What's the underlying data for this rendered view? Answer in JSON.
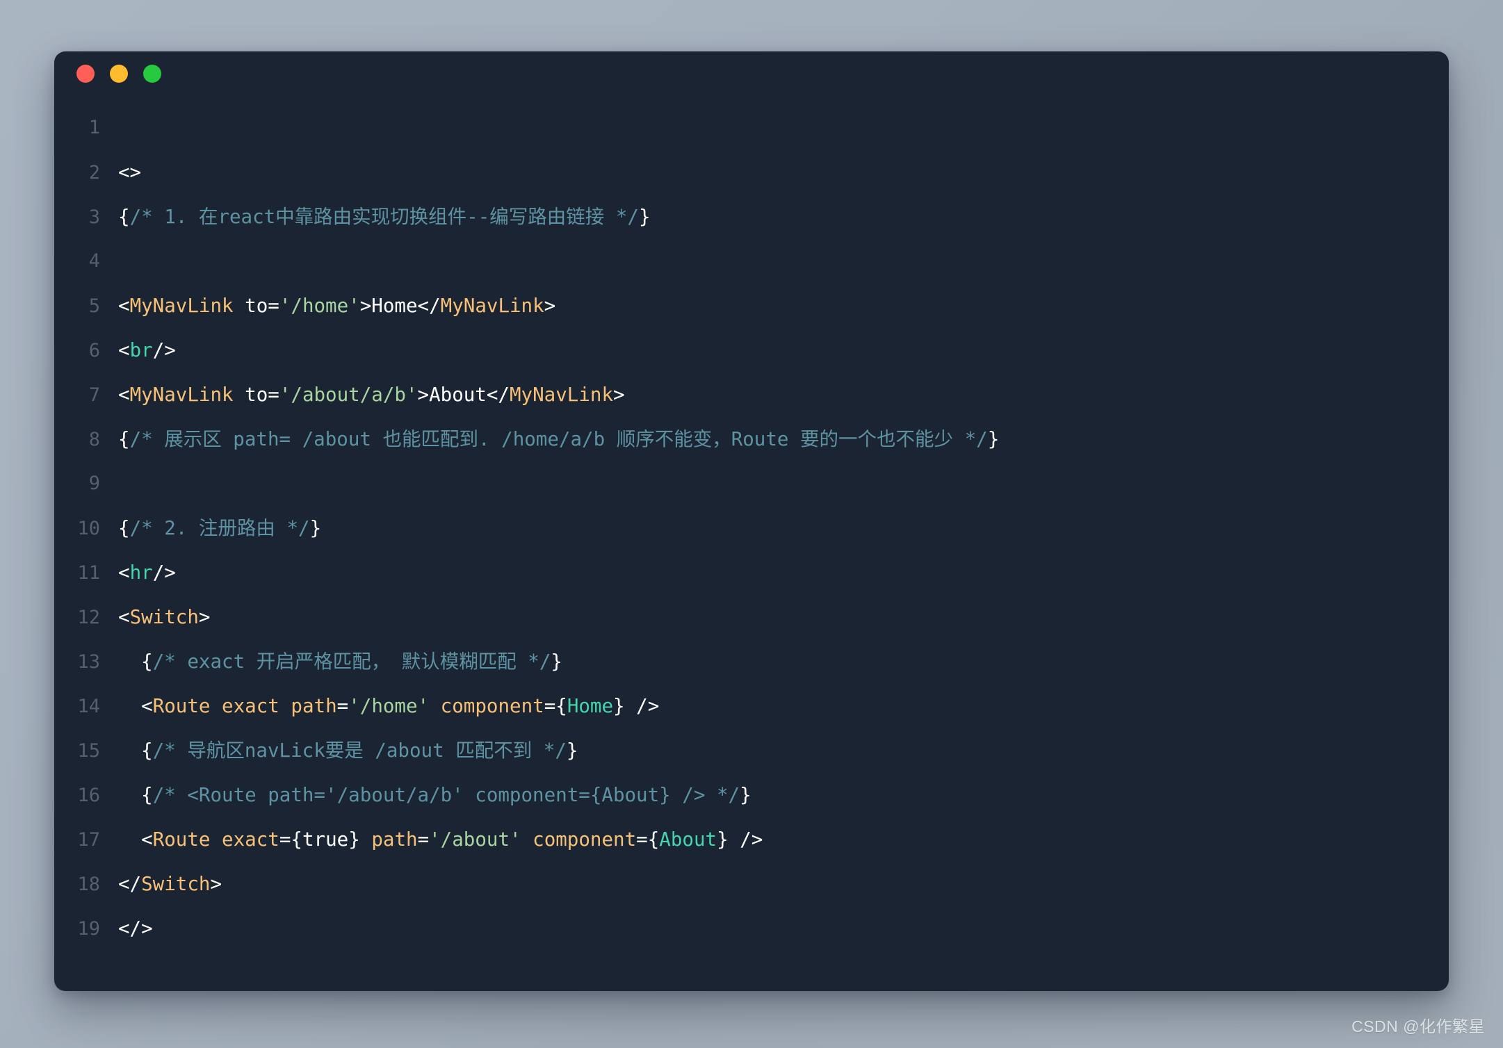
{
  "window": {
    "background_color": "#1b2433",
    "traffic_lights": [
      {
        "name": "close",
        "color": "#ff5f56"
      },
      {
        "name": "minimize",
        "color": "#ffbd2e"
      },
      {
        "name": "maximize",
        "color": "#27c93f"
      }
    ]
  },
  "theme": {
    "page_background": "#a9b5c1",
    "line_number_color": "#54616f",
    "text_color": "#ffffff",
    "tag_color": "#f6c177",
    "html_tag_color": "#45d6ac",
    "string_color": "#a8d6a0",
    "expression_color": "#45d6ac",
    "comment_color": "#5d93a3"
  },
  "code": {
    "language": "jsx",
    "line_numbers": [
      "1",
      "2",
      "3",
      "4",
      "5",
      "6",
      "7",
      "8",
      "9",
      "10",
      "11",
      "12",
      "13",
      "14",
      "15",
      "16",
      "17",
      "18",
      "19"
    ],
    "lines": [
      {
        "number": "1",
        "tokens": []
      },
      {
        "number": "2",
        "tokens": [
          {
            "t": "<>",
            "c": "punct"
          }
        ]
      },
      {
        "number": "3",
        "tokens": [
          {
            "t": "{",
            "c": "brace"
          },
          {
            "t": "/* 1. 在react中靠路由实现切换组件--编写路由链接 */",
            "c": "comment"
          },
          {
            "t": "}",
            "c": "brace"
          }
        ]
      },
      {
        "number": "4",
        "tokens": []
      },
      {
        "number": "5",
        "tokens": [
          {
            "t": "<",
            "c": "punct"
          },
          {
            "t": "MyNavLink",
            "c": "tag"
          },
          {
            "t": " ",
            "c": "text"
          },
          {
            "t": "to",
            "c": "text"
          },
          {
            "t": "=",
            "c": "punct"
          },
          {
            "t": "'/home'",
            "c": "string"
          },
          {
            "t": ">",
            "c": "punct"
          },
          {
            "t": "Home",
            "c": "text"
          },
          {
            "t": "</",
            "c": "punct"
          },
          {
            "t": "MyNavLink",
            "c": "tag"
          },
          {
            "t": ">",
            "c": "punct"
          }
        ]
      },
      {
        "number": "6",
        "tokens": [
          {
            "t": "<",
            "c": "punct"
          },
          {
            "t": "br",
            "c": "htmltag"
          },
          {
            "t": "/>",
            "c": "punct"
          }
        ]
      },
      {
        "number": "7",
        "tokens": [
          {
            "t": "<",
            "c": "punct"
          },
          {
            "t": "MyNavLink",
            "c": "tag"
          },
          {
            "t": " ",
            "c": "text"
          },
          {
            "t": "to",
            "c": "text"
          },
          {
            "t": "=",
            "c": "punct"
          },
          {
            "t": "'/about/a/b'",
            "c": "string"
          },
          {
            "t": ">",
            "c": "punct"
          },
          {
            "t": "About",
            "c": "text"
          },
          {
            "t": "</",
            "c": "punct"
          },
          {
            "t": "MyNavLink",
            "c": "tag"
          },
          {
            "t": ">",
            "c": "punct"
          }
        ]
      },
      {
        "number": "8",
        "tokens": [
          {
            "t": "{",
            "c": "brace"
          },
          {
            "t": "/* 展示区 path= /about 也能匹配到. /home/a/b 顺序不能变，Route 要的一个也不能少 */",
            "c": "comment"
          },
          {
            "t": "}",
            "c": "brace"
          }
        ]
      },
      {
        "number": "9",
        "tokens": []
      },
      {
        "number": "10",
        "tokens": [
          {
            "t": "{",
            "c": "brace"
          },
          {
            "t": "/* 2. 注册路由 */",
            "c": "comment"
          },
          {
            "t": "}",
            "c": "brace"
          }
        ]
      },
      {
        "number": "11",
        "tokens": [
          {
            "t": "<",
            "c": "punct"
          },
          {
            "t": "hr",
            "c": "htmltag"
          },
          {
            "t": "/>",
            "c": "punct"
          }
        ]
      },
      {
        "number": "12",
        "tokens": [
          {
            "t": "<",
            "c": "punct"
          },
          {
            "t": "Switch",
            "c": "tag"
          },
          {
            "t": ">",
            "c": "punct"
          }
        ]
      },
      {
        "number": "13",
        "tokens": [
          {
            "t": "  ",
            "c": "text"
          },
          {
            "t": "{",
            "c": "brace"
          },
          {
            "t": "/* exact 开启严格匹配， 默认模糊匹配 */",
            "c": "comment"
          },
          {
            "t": "}",
            "c": "brace"
          }
        ]
      },
      {
        "number": "14",
        "tokens": [
          {
            "t": "  ",
            "c": "text"
          },
          {
            "t": "<",
            "c": "punct"
          },
          {
            "t": "Route",
            "c": "tag"
          },
          {
            "t": " ",
            "c": "text"
          },
          {
            "t": "exact",
            "c": "attr"
          },
          {
            "t": " ",
            "c": "text"
          },
          {
            "t": "path",
            "c": "attr"
          },
          {
            "t": "=",
            "c": "punct"
          },
          {
            "t": "'/home'",
            "c": "string"
          },
          {
            "t": " ",
            "c": "text"
          },
          {
            "t": "component",
            "c": "attr"
          },
          {
            "t": "=",
            "c": "punct"
          },
          {
            "t": "{",
            "c": "brace"
          },
          {
            "t": "Home",
            "c": "expr"
          },
          {
            "t": "}",
            "c": "brace"
          },
          {
            "t": " />",
            "c": "punct"
          }
        ]
      },
      {
        "number": "15",
        "tokens": [
          {
            "t": "  ",
            "c": "text"
          },
          {
            "t": "{",
            "c": "brace"
          },
          {
            "t": "/* 导航区navLick要是 /about 匹配不到 */",
            "c": "comment"
          },
          {
            "t": "}",
            "c": "brace"
          }
        ]
      },
      {
        "number": "16",
        "tokens": [
          {
            "t": "  ",
            "c": "text"
          },
          {
            "t": "{",
            "c": "brace"
          },
          {
            "t": "/* <Route path='/about/a/b' component={About} /> */",
            "c": "comment"
          },
          {
            "t": "}",
            "c": "brace"
          }
        ]
      },
      {
        "number": "17",
        "tokens": [
          {
            "t": "  ",
            "c": "text"
          },
          {
            "t": "<",
            "c": "punct"
          },
          {
            "t": "Route",
            "c": "tag"
          },
          {
            "t": " ",
            "c": "text"
          },
          {
            "t": "exact",
            "c": "attr"
          },
          {
            "t": "=",
            "c": "punct"
          },
          {
            "t": "{",
            "c": "brace"
          },
          {
            "t": "true",
            "c": "text"
          },
          {
            "t": "}",
            "c": "brace"
          },
          {
            "t": " ",
            "c": "text"
          },
          {
            "t": "path",
            "c": "attr"
          },
          {
            "t": "=",
            "c": "punct"
          },
          {
            "t": "'/about'",
            "c": "string"
          },
          {
            "t": " ",
            "c": "text"
          },
          {
            "t": "component",
            "c": "attr"
          },
          {
            "t": "=",
            "c": "punct"
          },
          {
            "t": "{",
            "c": "brace"
          },
          {
            "t": "About",
            "c": "expr"
          },
          {
            "t": "}",
            "c": "brace"
          },
          {
            "t": " />",
            "c": "punct"
          }
        ]
      },
      {
        "number": "18",
        "tokens": [
          {
            "t": "</",
            "c": "punct"
          },
          {
            "t": "Switch",
            "c": "tag"
          },
          {
            "t": ">",
            "c": "punct"
          }
        ]
      },
      {
        "number": "19",
        "tokens": [
          {
            "t": "</>",
            "c": "punct"
          }
        ]
      }
    ]
  },
  "watermark": {
    "text": "CSDN @化作繁星"
  }
}
